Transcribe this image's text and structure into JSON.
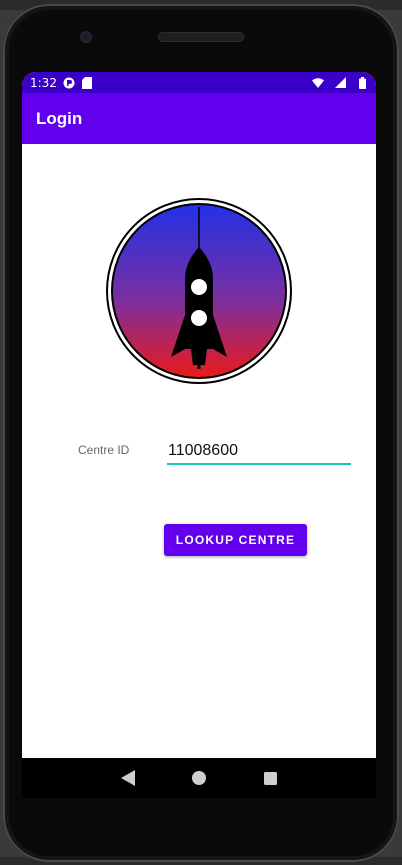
{
  "status_bar": {
    "time": "1:32",
    "icons": [
      "launcher-icon",
      "sd-card-icon",
      "wifi-icon",
      "signal-icon",
      "battery-icon"
    ]
  },
  "app_bar": {
    "title": "Login"
  },
  "logo": {
    "icon": "rocket-icon",
    "gradient_top": "#2331e6",
    "gradient_bottom": "#ea1a1a"
  },
  "form": {
    "centre_id_label": "Centre ID",
    "centre_id_value": "11008600",
    "lookup_button_label": "LOOKUP CENTRE"
  },
  "nav_bar": {
    "buttons": [
      "back-icon",
      "home-icon",
      "recents-icon"
    ]
  },
  "colors": {
    "primary": "#6200ee",
    "primary_dark": "#3a00c9",
    "accent": "#15c7b9"
  }
}
